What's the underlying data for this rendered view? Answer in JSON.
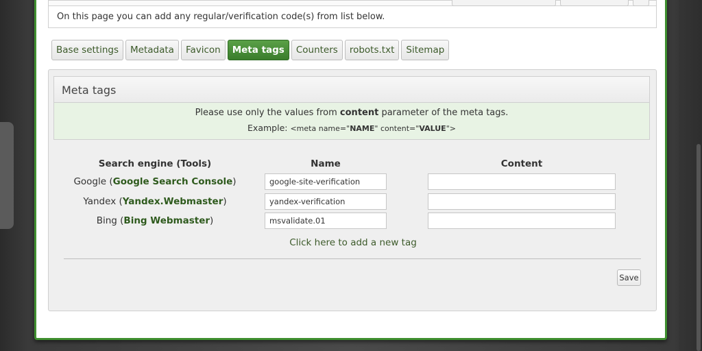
{
  "info": {
    "text": "On this page you can add any regular/verification code(s) from list below."
  },
  "tabs": [
    {
      "label": "Base settings",
      "active": false
    },
    {
      "label": "Metadata",
      "active": false
    },
    {
      "label": "Favicon",
      "active": false
    },
    {
      "label": "Meta tags",
      "active": true
    },
    {
      "label": "Counters",
      "active": false
    },
    {
      "label": "robots.txt",
      "active": false
    },
    {
      "label": "Sitemap",
      "active": false
    }
  ],
  "meta": {
    "header": "Meta tags",
    "note_pre": "Please use only the values from ",
    "note_bold": "content",
    "note_post": " parameter of the meta tags.",
    "example_label": "Example:",
    "example_code_1": "<meta name=\"",
    "example_name": "NAME",
    "example_code_2": "\" content=\"",
    "example_value": "VALUE",
    "example_code_3": "\">"
  },
  "table": {
    "col_engine": "Search engine (Tools)",
    "col_name": "Name",
    "col_content": "Content",
    "rows": [
      {
        "engine": "Google",
        "tool": "Google Search Console",
        "name": "google-site-verification",
        "content": ""
      },
      {
        "engine": "Yandex",
        "tool": "Yandex.Webmaster",
        "name": "yandex-verification",
        "content": ""
      },
      {
        "engine": "Bing",
        "tool": "Bing Webmaster",
        "name": "msvalidate.01",
        "content": ""
      }
    ],
    "add_link": "Click here to add a new tag",
    "save": "Save"
  },
  "colors": {
    "accent": "#3f8f2f",
    "link": "#2e5a1d",
    "note_bg": "#e8f3e4"
  }
}
